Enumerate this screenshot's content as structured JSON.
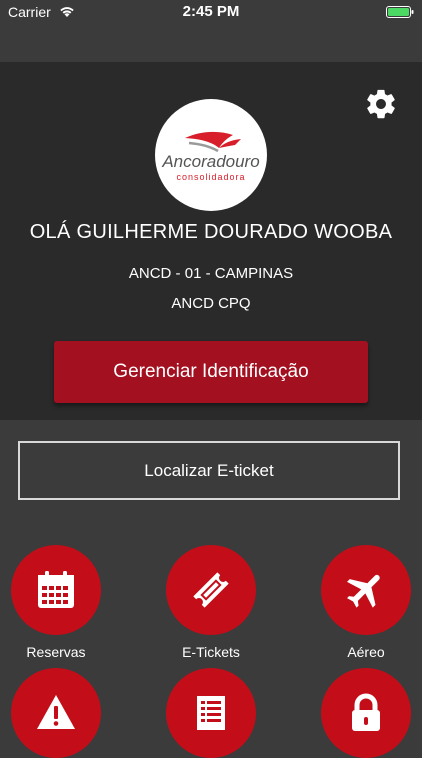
{
  "status": {
    "carrier": "Carrier",
    "time": "2:45 PM"
  },
  "header": {
    "logo_brand": "Ancoradouro",
    "logo_tagline": "consolidadora",
    "greeting": "OLÁ GUILHERME DOURADO WOOBA",
    "agency": "ANCD - 01 - CAMPINAS",
    "branch": "ANCD CPQ",
    "manage_button": "Gerenciar Identificação"
  },
  "eticket_button": "Localizar E-ticket",
  "tiles": [
    {
      "label": "Reservas",
      "icon": "calendar-icon"
    },
    {
      "label": "E-Tickets",
      "icon": "ticket-icon"
    },
    {
      "label": "Aéreo",
      "icon": "airplane-icon"
    },
    {
      "label": "",
      "icon": "warning-icon"
    },
    {
      "label": "",
      "icon": "list-icon"
    },
    {
      "label": "",
      "icon": "lock-icon"
    }
  ],
  "colors": {
    "accent": "#c30e19",
    "button": "#a3101f",
    "header_bg": "#2a2a2a",
    "page_bg": "#3b3b3b"
  }
}
